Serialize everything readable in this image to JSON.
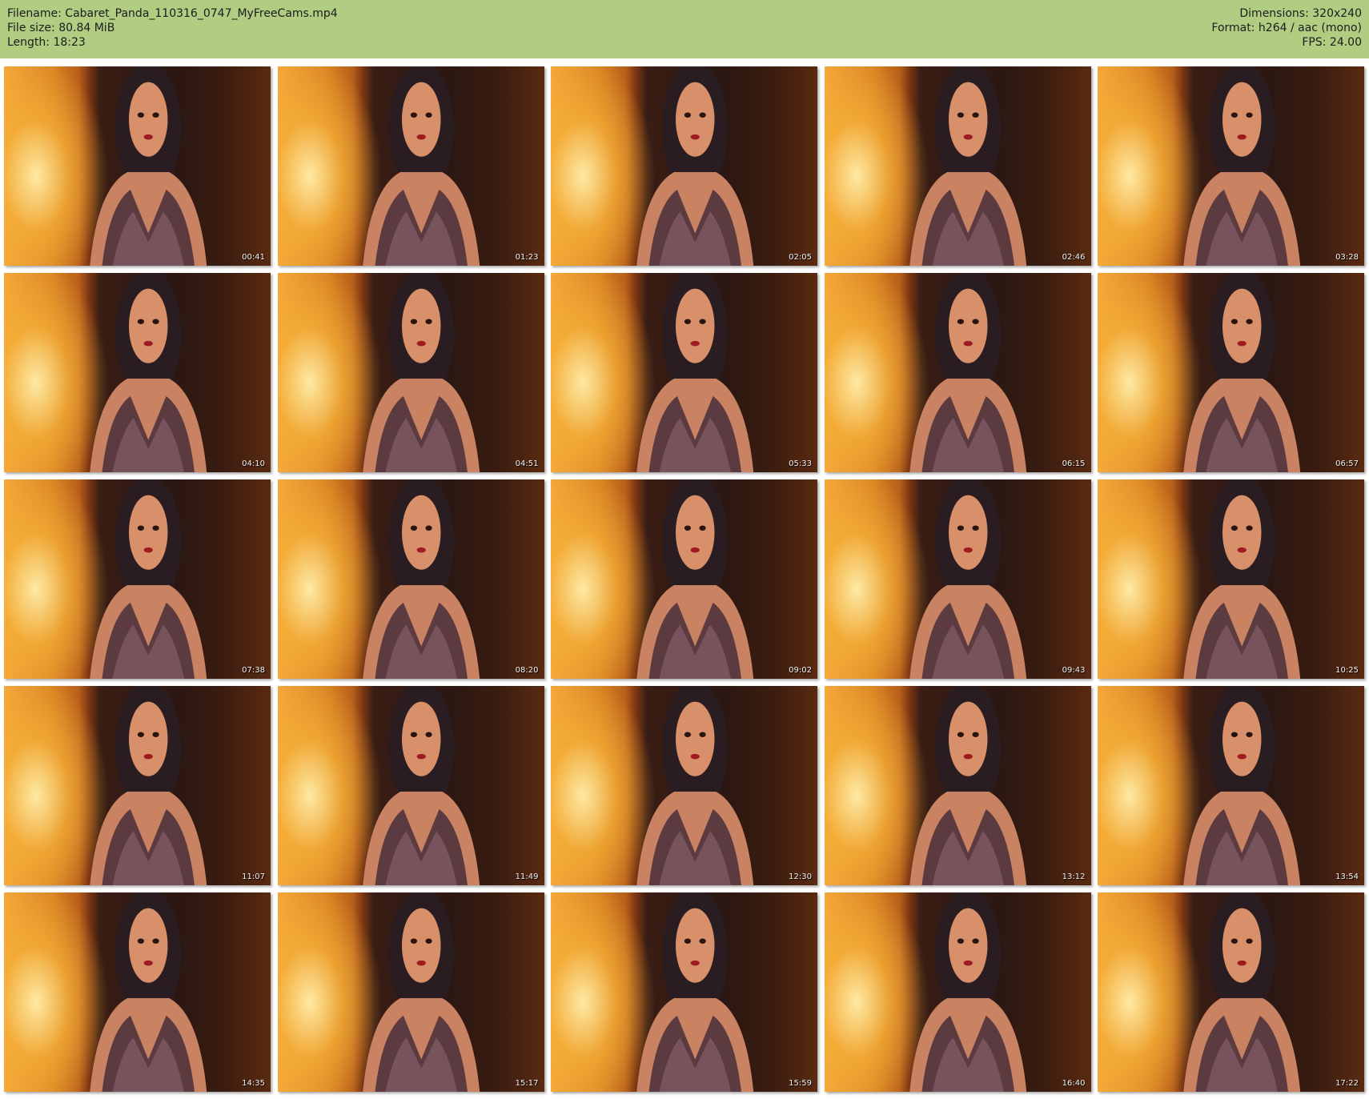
{
  "header": {
    "filename_line": "Filename: Cabaret_Panda_110316_0747_MyFreeCams.mp4",
    "filesize_line": "File size: 80.84 MiB",
    "length_line": "Length: 18:23",
    "dimensions_line": "Dimensions: 320x240",
    "format_line": "Format: h264 / aac (mono)",
    "fps_line": "FPS: 24.00"
  },
  "thumbnails": [
    {
      "timestamp": "00:41"
    },
    {
      "timestamp": "01:23"
    },
    {
      "timestamp": "02:05"
    },
    {
      "timestamp": "02:46"
    },
    {
      "timestamp": "03:28"
    },
    {
      "timestamp": "04:10"
    },
    {
      "timestamp": "04:51"
    },
    {
      "timestamp": "05:33"
    },
    {
      "timestamp": "06:15"
    },
    {
      "timestamp": "06:57"
    },
    {
      "timestamp": "07:38"
    },
    {
      "timestamp": "08:20"
    },
    {
      "timestamp": "09:02"
    },
    {
      "timestamp": "09:43"
    },
    {
      "timestamp": "10:25"
    },
    {
      "timestamp": "11:07"
    },
    {
      "timestamp": "11:49"
    },
    {
      "timestamp": "12:30"
    },
    {
      "timestamp": "13:12"
    },
    {
      "timestamp": "13:54"
    },
    {
      "timestamp": "14:35"
    },
    {
      "timestamp": "15:17"
    },
    {
      "timestamp": "15:59"
    },
    {
      "timestamp": "16:40"
    },
    {
      "timestamp": "17:22"
    }
  ],
  "colors": {
    "header_bg": "#b1cd82",
    "header_text": "#1c1c1c"
  }
}
